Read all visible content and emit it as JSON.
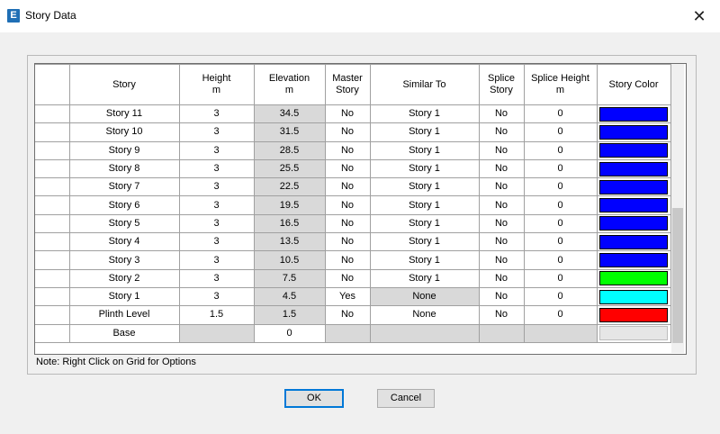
{
  "window": {
    "title": "Story Data",
    "app_icon": "E"
  },
  "columns": [
    {
      "label": "Story",
      "unit": ""
    },
    {
      "label": "Height",
      "unit": "m"
    },
    {
      "label": "Elevation",
      "unit": "m"
    },
    {
      "label": "Master Story",
      "unit": ""
    },
    {
      "label": "Similar To",
      "unit": ""
    },
    {
      "label": "Splice Story",
      "unit": ""
    },
    {
      "label": "Splice Height",
      "unit": "m"
    },
    {
      "label": "Story Color",
      "unit": ""
    }
  ],
  "rows": [
    {
      "story": "Story 11",
      "height": "3",
      "elevation": "34.5",
      "master": "No",
      "similar": "Story  1",
      "splice": "No",
      "splice_height": "0",
      "color": "#0000ff"
    },
    {
      "story": "Story 10",
      "height": "3",
      "elevation": "31.5",
      "master": "No",
      "similar": "Story  1",
      "splice": "No",
      "splice_height": "0",
      "color": "#0000ff"
    },
    {
      "story": "Story 9",
      "height": "3",
      "elevation": "28.5",
      "master": "No",
      "similar": "Story  1",
      "splice": "No",
      "splice_height": "0",
      "color": "#0000ff"
    },
    {
      "story": "Story 8",
      "height": "3",
      "elevation": "25.5",
      "master": "No",
      "similar": "Story  1",
      "splice": "No",
      "splice_height": "0",
      "color": "#0000ff"
    },
    {
      "story": "Story 7",
      "height": "3",
      "elevation": "22.5",
      "master": "No",
      "similar": "Story  1",
      "splice": "No",
      "splice_height": "0",
      "color": "#0000ff"
    },
    {
      "story": "Story 6",
      "height": "3",
      "elevation": "19.5",
      "master": "No",
      "similar": "Story  1",
      "splice": "No",
      "splice_height": "0",
      "color": "#0000ff"
    },
    {
      "story": "Story 5",
      "height": "3",
      "elevation": "16.5",
      "master": "No",
      "similar": "Story  1",
      "splice": "No",
      "splice_height": "0",
      "color": "#0000ff"
    },
    {
      "story": "Story 4",
      "height": "3",
      "elevation": "13.5",
      "master": "No",
      "similar": "Story  1",
      "splice": "No",
      "splice_height": "0",
      "color": "#0000ff"
    },
    {
      "story": "Story 3",
      "height": "3",
      "elevation": "10.5",
      "master": "No",
      "similar": "Story  1",
      "splice": "No",
      "splice_height": "0",
      "color": "#0000ff"
    },
    {
      "story": "Story 2",
      "height": "3",
      "elevation": "7.5",
      "master": "No",
      "similar": "Story  1",
      "splice": "No",
      "splice_height": "0",
      "color": "#00ff00"
    },
    {
      "story": "Story  1",
      "height": "3",
      "elevation": "4.5",
      "master": "Yes",
      "similar": "None",
      "splice": "No",
      "splice_height": "0",
      "color": "#00ffff"
    },
    {
      "story": "Plinth Level",
      "height": "1.5",
      "elevation": "1.5",
      "master": "No",
      "similar": "None",
      "splice": "No",
      "splice_height": "0",
      "color": "#ff0000"
    },
    {
      "story": "Base",
      "height": "",
      "elevation": "0",
      "master": "",
      "similar": "",
      "splice": "",
      "splice_height": "",
      "color": ""
    }
  ],
  "note": "Note:  Right Click on Grid for Options",
  "buttons": {
    "ok": "OK",
    "cancel": "Cancel"
  }
}
